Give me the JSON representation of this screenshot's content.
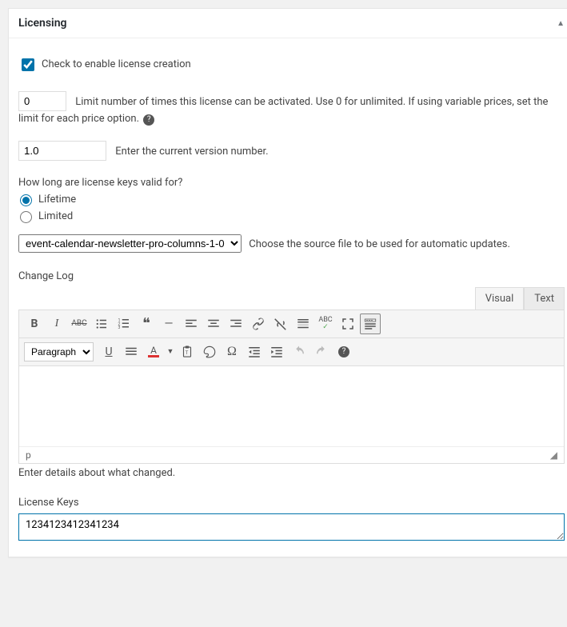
{
  "panel": {
    "title": "Licensing"
  },
  "enable": {
    "label": "Check to enable license creation",
    "checked": true
  },
  "limit": {
    "value": "0",
    "label": "Limit number of times this license can be activated. Use 0 for unlimited. If using variable prices, set the limit for each price option."
  },
  "version": {
    "value": "1.0",
    "label": "Enter the current version number."
  },
  "validity": {
    "question": "How long are license keys valid for?",
    "options": {
      "lifetime": "Lifetime",
      "limited": "Limited"
    },
    "selected": "lifetime"
  },
  "source": {
    "selected": "event-calendar-newsletter-pro-columns-1-0",
    "label": "Choose the source file to be used for automatic updates."
  },
  "changelog": {
    "heading": "Change Log",
    "tabs": {
      "visual": "Visual",
      "text": "Text"
    },
    "paragraph": "Paragraph",
    "status_path": "p",
    "help": "Enter details about what changed."
  },
  "keys": {
    "heading": "License Keys",
    "value": "1234123412341234"
  },
  "colors": {
    "accent": "#0073aa"
  }
}
